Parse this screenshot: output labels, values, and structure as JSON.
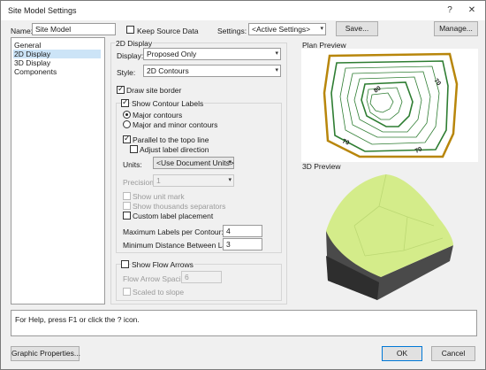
{
  "window": {
    "title": "Site Model Settings",
    "help_glyph": "?",
    "close_glyph": "✕"
  },
  "top": {
    "name_label": "Name:",
    "name_value": "Site Model",
    "keep_source_label": "Keep Source Data",
    "settings_label": "Settings:",
    "settings_value": "<Active Settings>",
    "save_label": "Save...",
    "manage_label": "Manage..."
  },
  "nav": {
    "items": [
      "General",
      "2D Display",
      "3D Display",
      "Components"
    ],
    "selected": "2D Display"
  },
  "display2d": {
    "heading": "2D Display",
    "display_label": "Display:",
    "display_value": "Proposed Only",
    "style_label": "Style:",
    "style_value": "2D Contours",
    "draw_border_label": "Draw site border",
    "show_contour_labels": "Show Contour Labels",
    "major_contours": "Major contours",
    "major_minor_contours": "Major and minor contours",
    "parallel_label": "Parallel to the topo line",
    "adjust_label": "Adjust label direction",
    "units_label": "Units:",
    "units_value": "<Use Document Units>",
    "precision_label": "Precision:",
    "precision_value": "1",
    "show_unit_mark": "Show unit mark",
    "show_thousands": "Show thousands separators",
    "custom_placement": "Custom label placement",
    "max_labels_label": "Maximum Labels per Contour:",
    "max_labels_value": "4",
    "min_distance_label": "Minimum Distance Between Labels:",
    "min_distance_value": "3",
    "show_flow_arrows": "Show Flow Arrows",
    "flow_spacing_label": "Flow Arrow Spacing:",
    "flow_spacing_value": "6",
    "scaled_slope": "Scaled to slope"
  },
  "preview": {
    "plan_heading": "Plan Preview",
    "preview3d_heading": "3D Preview",
    "contour_labels": [
      "80",
      "70",
      "70",
      "70"
    ],
    "colors": {
      "border": "#b8860b",
      "contour": "#2e7d32",
      "terrain_top": "#d4ec8a",
      "terrain_side": "#4a4a4a"
    }
  },
  "help": {
    "text": "For Help, press F1 or click the ? icon."
  },
  "footer": {
    "graphic_props": "Graphic Properties...",
    "ok": "OK",
    "cancel": "Cancel"
  }
}
